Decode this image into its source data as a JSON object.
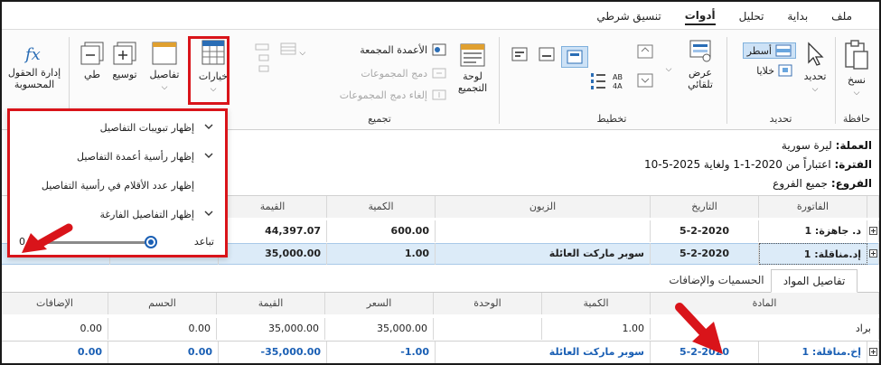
{
  "menu": {
    "items": [
      "ملف",
      "بداية",
      "تحليل",
      "أدوات",
      "تنسيق شرطي"
    ],
    "active": "أدوات"
  },
  "ribbon": {
    "paste_label": "نسخ",
    "select_label": "تحديد",
    "rows_label": "أسطر",
    "cells_label": "خلايا",
    "autoview_label_1": "عرض",
    "autoview_label_2": "تلقائي",
    "pivot_label_1": "لوحة",
    "pivot_label_2": "التجميع",
    "grouped_columns": "الأعمدة المجمعة",
    "merge_groups": "دمج المجموعات",
    "unmerge_groups": "إلغاء دمج المجموعات",
    "options_label": "خيارات",
    "details_label": "تفاصيل",
    "expand_label": "توسيع",
    "collapse_label": "طي",
    "calc_fields_1": "إدارة الحقول",
    "calc_fields_2": "المحسوبة",
    "sortaz_label": "AB A‍Z",
    "groups": {
      "clipboard": "حافظة",
      "select": "تحديد",
      "layout": "تخطيط",
      "grouping": "تجميع"
    }
  },
  "info": {
    "currency_label": "العملة:",
    "currency_value": "ليرة سورية",
    "period_label": "الفترة:",
    "period_value": "اعتباراً من 2020-1-1 ولغاية 2025-5-10",
    "branches_label": "الفروع:",
    "branches_value": "جميع الفروع"
  },
  "main_table": {
    "headers": [
      "الفاتورة",
      "التاريخ",
      "الزبون",
      "الكمية",
      "القيمة"
    ],
    "rows": [
      {
        "invoice": "د. جاهزة: 1",
        "date": "5-2-2020",
        "customer": "",
        "qty": "600.00",
        "value": "44,397.07",
        "hidden1": "",
        "hidden2": ""
      },
      {
        "invoice": "إد.مناقلة: 1",
        "date": "5-2-2020",
        "customer": "سوبر ماركت العائلة",
        "qty": "1.00",
        "value": "35,000.00",
        "hidden1": "0.00",
        "hidden2": "0.00"
      }
    ]
  },
  "detail_tabs": [
    "تفاصيل المواد",
    "الحسميات والإضافات"
  ],
  "detail_table": {
    "headers": [
      "المادة",
      "الكمية",
      "الوحدة",
      "السعر",
      "القيمة",
      "الحسم",
      "الإضافات"
    ],
    "rows": [
      {
        "item": "براد",
        "qty": "1.00",
        "unit": "",
        "price": "35,000.00",
        "value": "35,000.00",
        "discount": "0.00",
        "additions": "0.00"
      }
    ]
  },
  "bottom_row": {
    "invoice": "إخ.مناقلة: 1",
    "date": "5-2-2020",
    "customer": "سوبر ماركت العائلة",
    "qty": "-1.00",
    "value": "-35,000.00",
    "discount": "0.00",
    "additions": "0.00"
  },
  "popup": {
    "items": [
      "إظهار تبويبات التفاصيل",
      "إظهار رأسية أعمدة التفاصيل",
      "إظهار عدد الأقلام في رأسية التفاصيل",
      "إظهار التفاصيل الفارغة"
    ],
    "checked": [
      true,
      true,
      false,
      true
    ],
    "spacing_label": "تباعد",
    "spacing_value": "0",
    "slider_fraction": 0.98
  },
  "colors": {
    "accent": "#1a5fb4",
    "highlight_row": "#dcebf8",
    "annotation_red": "#d9141a"
  }
}
